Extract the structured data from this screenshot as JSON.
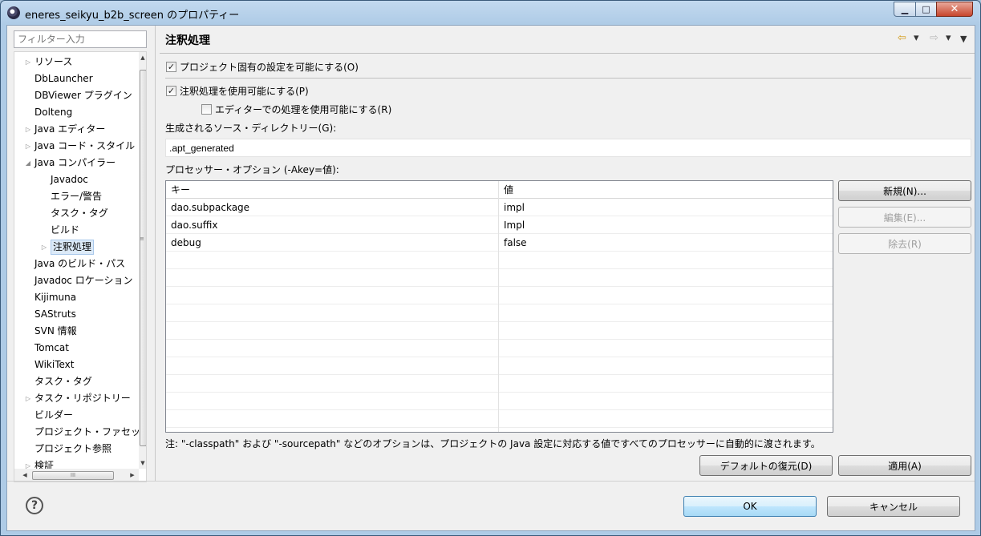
{
  "window": {
    "title": "eneres_seikyu_b2b_screen のプロパティー",
    "min_glyph": "▁",
    "max_glyph": "□",
    "close_glyph": "✕"
  },
  "filter": {
    "placeholder": "フィルター入力"
  },
  "tree": {
    "items": [
      {
        "label": "リソース",
        "arrow": "▷",
        "indent": 0
      },
      {
        "label": "DbLauncher",
        "arrow": "",
        "indent": 0
      },
      {
        "label": "DBViewer プラグイン",
        "arrow": "",
        "indent": 0
      },
      {
        "label": "Dolteng",
        "arrow": "",
        "indent": 0
      },
      {
        "label": "Java エディター",
        "arrow": "▷",
        "indent": 0
      },
      {
        "label": "Java コード・スタイル",
        "arrow": "▷",
        "indent": 0
      },
      {
        "label": "Java コンパイラー",
        "arrow": "◢",
        "indent": 0
      },
      {
        "label": "Javadoc",
        "arrow": "",
        "indent": 1
      },
      {
        "label": "エラー/警告",
        "arrow": "",
        "indent": 1
      },
      {
        "label": "タスク・タグ",
        "arrow": "",
        "indent": 1
      },
      {
        "label": "ビルド",
        "arrow": "",
        "indent": 1
      },
      {
        "label": "注釈処理",
        "arrow": "▷",
        "indent": 1,
        "selected": true
      },
      {
        "label": "Java のビルド・パス",
        "arrow": "",
        "indent": 0
      },
      {
        "label": "Javadoc ロケーション",
        "arrow": "",
        "indent": 0
      },
      {
        "label": "Kijimuna",
        "arrow": "",
        "indent": 0
      },
      {
        "label": "SAStruts",
        "arrow": "",
        "indent": 0
      },
      {
        "label": "SVN 情報",
        "arrow": "",
        "indent": 0
      },
      {
        "label": "Tomcat",
        "arrow": "",
        "indent": 0
      },
      {
        "label": "WikiText",
        "arrow": "",
        "indent": 0
      },
      {
        "label": "タスク・タグ",
        "arrow": "",
        "indent": 0
      },
      {
        "label": "タスク・リポジトリー",
        "arrow": "▷",
        "indent": 0
      },
      {
        "label": "ビルダー",
        "arrow": "",
        "indent": 0
      },
      {
        "label": "プロジェクト・ファセット",
        "arrow": "",
        "indent": 0
      },
      {
        "label": "プロジェクト参照",
        "arrow": "",
        "indent": 0
      },
      {
        "label": "検証",
        "arrow": "▷",
        "indent": 0
      }
    ],
    "scroll_up": "▲",
    "scroll_down": "▼",
    "scroll_left": "◀",
    "scroll_right": "▶",
    "vgrip": "≡",
    "hgrip": "III"
  },
  "pane": {
    "title": "注釈処理",
    "nav": {
      "back": "⇦",
      "menu1": "▾",
      "forward": "⇨",
      "menu2": "▾",
      "view_menu": "▼"
    },
    "project_specific": {
      "label": "プロジェクト固有の設定を可能にする(O)",
      "checked": true
    },
    "enable_annotation": {
      "label": "注釈処理を使用可能にする(P)",
      "checked": true
    },
    "enable_editor": {
      "label": "エディターでの処理を使用可能にする(R)",
      "checked": false
    },
    "source_dir_label": "生成されるソース・ディレクトリー(G):",
    "source_dir_value": ".apt_generated",
    "options_label": "プロセッサー・オプション (-Akey=値):",
    "table": {
      "headers": [
        "キー",
        "値"
      ],
      "rows": [
        [
          "dao.subpackage",
          "impl"
        ],
        [
          "dao.suffix",
          "Impl"
        ],
        [
          "debug",
          "false"
        ],
        [
          "",
          ""
        ],
        [
          "",
          ""
        ],
        [
          "",
          ""
        ],
        [
          "",
          ""
        ],
        [
          "",
          ""
        ],
        [
          "",
          ""
        ],
        [
          "",
          ""
        ],
        [
          "",
          ""
        ],
        [
          "",
          ""
        ],
        [
          "",
          ""
        ]
      ]
    },
    "buttons": {
      "new": "新規(N)...",
      "edit": "編集(E)...",
      "remove": "除去(R)"
    },
    "note": "注: \"-classpath\" および \"-sourcepath\" などのオプションは、プロジェクトの Java 設定に対応する値ですべてのプロセッサーに自動的に渡されます。",
    "restore_defaults": "デフォルトの復元(D)",
    "apply": "適用(A)"
  },
  "footer": {
    "help": "?",
    "ok": "OK",
    "cancel": "キャンセル"
  }
}
